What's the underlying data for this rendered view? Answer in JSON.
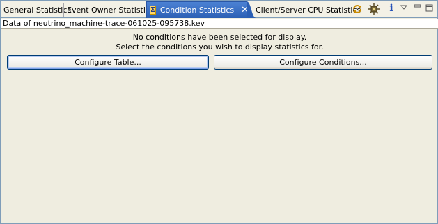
{
  "tabs": [
    {
      "label": "General Statistics"
    },
    {
      "label": "Event Owner Statistics"
    },
    {
      "label": "Condition Statistics",
      "active": true
    },
    {
      "label": "Client/Server CPU Statistics"
    }
  ],
  "toolbar": {
    "icons": [
      "refresh-icon",
      "settings-icon",
      "info-icon",
      "view-menu-icon",
      "minimize-icon",
      "maximize-icon"
    ],
    "info_glyph": "i"
  },
  "info_line": "Data of neutrino_machine-trace-061025-095738.kev",
  "message": {
    "line1": "No conditions have been selected for display.",
    "line2": "Select the conditions you wish to display statistics for."
  },
  "buttons": {
    "configure_table": "Configure Table...",
    "configure_conditions": "Configure Conditions..."
  },
  "colors": {
    "active_tab": "#3f72c4",
    "panel_bg": "#efede0",
    "button_border": "#003c74"
  }
}
